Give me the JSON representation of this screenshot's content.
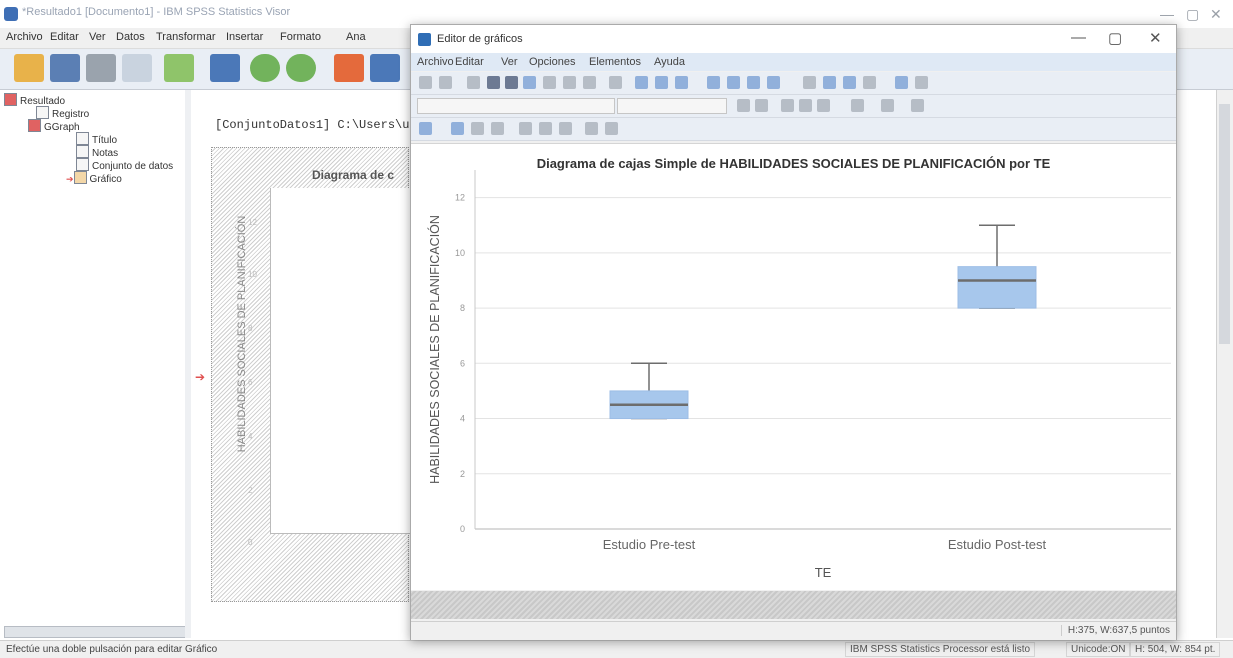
{
  "viewer": {
    "title": "*Resultado1 [Documento1] - IBM SPSS Statistics Visor",
    "menu": [
      "Archivo",
      "Editar",
      "Ver",
      "Datos",
      "Transformar",
      "Insertar",
      "Formato",
      "Ana"
    ],
    "outline": {
      "items": [
        {
          "label": "Resultado",
          "icon": "output-book-icon"
        },
        {
          "label": "Registro",
          "icon": "log-icon"
        },
        {
          "label": "GGraph",
          "icon": "output-book-icon"
        },
        {
          "label": "Título",
          "icon": "title-icon"
        },
        {
          "label": "Notas",
          "icon": "notes-icon"
        },
        {
          "label": "Conjunto de datos",
          "icon": "dataset-icon"
        },
        {
          "label": "Gráfico",
          "icon": "chart-icon"
        }
      ]
    },
    "content": {
      "path_text": "[ConjuntoDatos1] C:\\Users\\u",
      "chart_title_partial": "Diagrama de c",
      "ylabel": "HABILIDADES SOCIALES DE PLANIFICACIÓN",
      "yticks": [
        "12",
        "10",
        "8",
        "6",
        "4",
        "2",
        "0"
      ]
    },
    "status": {
      "hint": "Efectúe una doble pulsación para editar Gráfico",
      "processor": "IBM SPSS Statistics Processor está listo",
      "unicode": "Unicode:ON",
      "size": "H: 504, W: 854 pt."
    }
  },
  "editor": {
    "title": "Editor de gráficos",
    "menu": [
      "Archivo",
      "Editar",
      "Ver",
      "Opciones",
      "Elementos",
      "Ayuda"
    ],
    "dimensions": "H:375, W:637,5 puntos"
  },
  "chart_data": {
    "type": "box",
    "title": "Diagrama de cajas Simple de HABILIDADES SOCIALES DE PLANIFICACIÓN por TE",
    "xlabel": "TE",
    "ylabel": "HABILIDADES SOCIALES DE PLANIFICACIÓN",
    "ylim": [
      0,
      13
    ],
    "yticks": [
      0,
      2,
      4,
      6,
      8,
      10,
      12
    ],
    "grid": true,
    "box_color": "#a7c7ec",
    "median_color": "#6d6d6d",
    "categories": [
      "Estudio Pre-test",
      "Estudio Post-test"
    ],
    "boxes": [
      {
        "min": 4,
        "q1": 4,
        "median": 4.5,
        "q3": 5,
        "max": 6
      },
      {
        "min": 8,
        "q1": 8,
        "median": 9,
        "q3": 9.5,
        "max": 11
      }
    ]
  }
}
